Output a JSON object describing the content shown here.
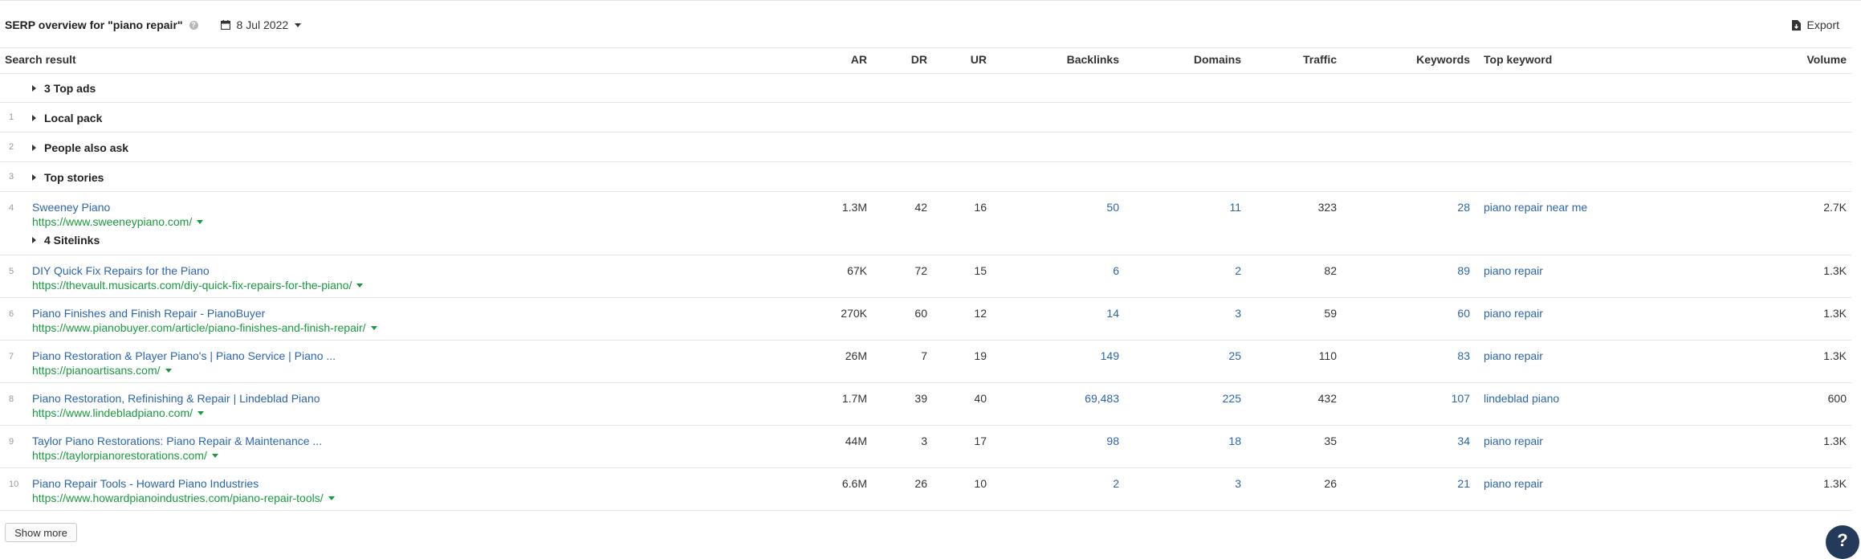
{
  "header": {
    "title": "SERP overview for \"piano repair\"",
    "help_icon": "?",
    "date": "8 Jul 2022",
    "export_label": "Export"
  },
  "columns": {
    "result": "Search result",
    "ar": "AR",
    "dr": "DR",
    "ur": "UR",
    "backlinks": "Backlinks",
    "domains": "Domains",
    "traffic": "Traffic",
    "keywords": "Keywords",
    "top_keyword": "Top keyword",
    "volume": "Volume"
  },
  "features": {
    "top_ads": "3 Top ads",
    "local_pack": {
      "num": "1",
      "label": "Local pack"
    },
    "people_also_ask": {
      "num": "2",
      "label": "People also ask"
    },
    "top_stories": {
      "num": "3",
      "label": "Top stories"
    },
    "sitelinks": "4 Sitelinks"
  },
  "results": [
    {
      "num": "4",
      "title": "Sweeney Piano",
      "url": "https://www.sweeneypiano.com/",
      "ar": "1.3M",
      "dr": "42",
      "ur": "16",
      "backlinks": "50",
      "domains": "11",
      "traffic": "323",
      "keywords": "28",
      "top_keyword": "piano repair near me",
      "volume": "2.7K"
    },
    {
      "num": "5",
      "title": "DIY Quick Fix Repairs for the Piano",
      "url": "https://thevault.musicarts.com/diy-quick-fix-repairs-for-the-piano/",
      "ar": "67K",
      "dr": "72",
      "ur": "15",
      "backlinks": "6",
      "domains": "2",
      "traffic": "82",
      "keywords": "89",
      "top_keyword": "piano repair",
      "volume": "1.3K"
    },
    {
      "num": "6",
      "title": "Piano Finishes and Finish Repair - PianoBuyer",
      "url": "https://www.pianobuyer.com/article/piano-finishes-and-finish-repair/",
      "ar": "270K",
      "dr": "60",
      "ur": "12",
      "backlinks": "14",
      "domains": "3",
      "traffic": "59",
      "keywords": "60",
      "top_keyword": "piano repair",
      "volume": "1.3K"
    },
    {
      "num": "7",
      "title": "Piano Restoration & Player Piano's | Piano Service | Piano ...",
      "url": "https://pianoartisans.com/",
      "ar": "26M",
      "dr": "7",
      "ur": "19",
      "backlinks": "149",
      "domains": "25",
      "traffic": "110",
      "keywords": "83",
      "top_keyword": "piano repair",
      "volume": "1.3K"
    },
    {
      "num": "8",
      "title": "Piano Restoration, Refinishing & Repair | Lindeblad Piano",
      "url": "https://www.lindebladpiano.com/",
      "ar": "1.7M",
      "dr": "39",
      "ur": "40",
      "backlinks": "69,483",
      "domains": "225",
      "traffic": "432",
      "keywords": "107",
      "top_keyword": "lindeblad piano",
      "volume": "600"
    },
    {
      "num": "9",
      "title": "Taylor Piano Restorations: Piano Repair & Maintenance ...",
      "url": "https://taylorpianorestorations.com/",
      "ar": "44M",
      "dr": "3",
      "ur": "17",
      "backlinks": "98",
      "domains": "18",
      "traffic": "35",
      "keywords": "34",
      "top_keyword": "piano repair",
      "volume": "1.3K"
    },
    {
      "num": "10",
      "title": "Piano Repair Tools - Howard Piano Industries",
      "url": "https://www.howardpianoindustries.com/piano-repair-tools/",
      "ar": "6.6M",
      "dr": "26",
      "ur": "10",
      "backlinks": "2",
      "domains": "3",
      "traffic": "26",
      "keywords": "21",
      "top_keyword": "piano repair",
      "volume": "1.3K"
    }
  ],
  "footer": {
    "show_more": "Show more",
    "help_button": "?"
  }
}
